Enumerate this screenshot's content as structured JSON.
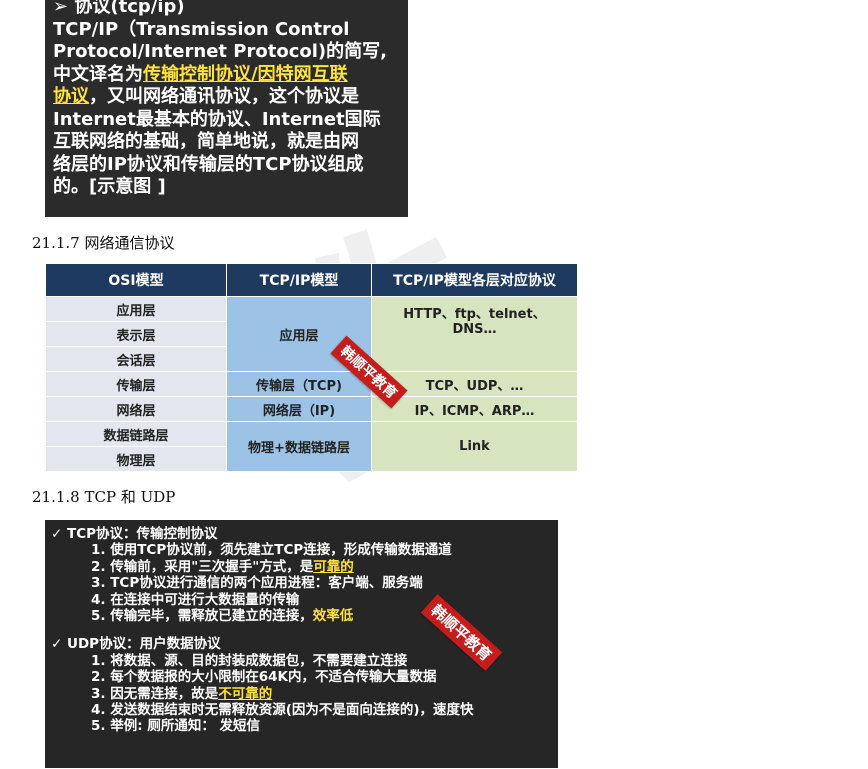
{
  "slide1": {
    "bullet": "➢",
    "title": "协议(tcp/ip)",
    "line1": "TCP/IP（Transmission Control",
    "line2": " Protocol/Internet Protocol)的简写,",
    "line3a": "中文译名为",
    "line3b": "传输控制协议/因特网互联",
    "line4a": "协议",
    "line4b": "，又叫网络通讯协议，这个协议是",
    "line5": "Internet最基本的协议、Internet国际",
    "line6": "互联网络的基础，简单地说，就是由网",
    "line7": "络层的IP协议和传输层的TCP协议组成",
    "line8": "的。[示意图 ]"
  },
  "heading1": "21.1.7   网络通信协议",
  "table": {
    "headers": [
      "OSI模型",
      "TCP/IP模型",
      "TCP/IP模型各层对应协议"
    ],
    "osi": [
      "应用层",
      "表示层",
      "会话层",
      "传输层",
      "网络层",
      "数据链路层",
      "物理层"
    ],
    "tcpip": [
      "应用层",
      "传输层（TCP)",
      "网络层（IP)",
      "物理+数据链路层"
    ],
    "protocols": [
      "HTTP、ftp、telnet、",
      "DNS…",
      "TCP、UDP、…",
      "IP、ICMP、ARP…",
      "Link"
    ]
  },
  "stamp": "韩顺平教育",
  "heading2": "21.1.8   TCP  和  UDP",
  "slide2": {
    "tcp_title": "✓ TCP协议：传输控制协议",
    "tcp1": "1.  使用TCP协议前，须先建立TCP连接，形成传输数据通道",
    "tcp2a": "2.  传输前，采用\"三次握手\"方式，是",
    "tcp2b": "可靠的",
    "tcp3": "3.  TCP协议进行通信的两个应用进程：客户端、服务端",
    "tcp4": "4.  在连接中可进行大数据量的传输",
    "tcp5a": "5.  传输完毕，需释放已建立的连接，",
    "tcp5b": "效率低",
    "udp_title": "✓ UDP协议：用户数据协议",
    "udp1": "1.  将数据、源、目的封装成数据包，不需要建立连接",
    "udp2": "2.  每个数据报的大小限制在64K内，不适合传输大量数据",
    "udp3a": "3.  因无需连接，故是",
    "udp3b": "不可靠的",
    "udp4": "4.  发送数据结束时无需释放资源(因为不是面向连接的)，速度快",
    "udp5": "5.  举例: 厕所通知： 发短信"
  }
}
